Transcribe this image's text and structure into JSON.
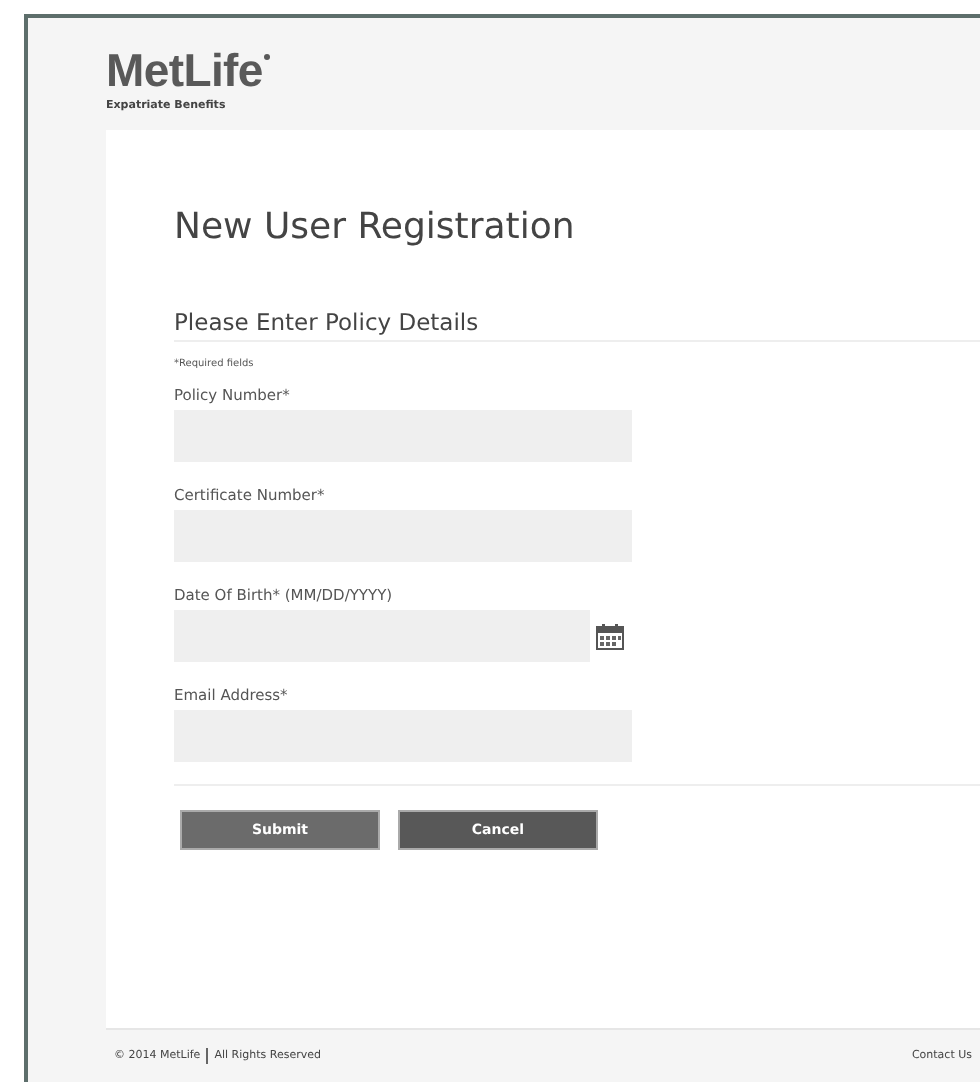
{
  "header": {
    "logo": "MetLife",
    "subtitle": "Expatriate Benefits"
  },
  "page_title": "New User Registration",
  "section_title": "Please Enter Policy Details",
  "required_note": "*Required fields",
  "fields": [
    {
      "label": "Policy Number*",
      "kind": "text"
    },
    {
      "label": "Certificate Number*",
      "kind": "text"
    },
    {
      "label": "Date Of Birth* (MM/DD/YYYY)",
      "kind": "date"
    },
    {
      "label": "Email Address*",
      "kind": "text"
    }
  ],
  "buttons": [
    {
      "label": "Submit",
      "kind": "primary"
    },
    {
      "label": "Cancel",
      "kind": "secondary"
    }
  ],
  "footer": {
    "copyright": "© 2014 MetLife",
    "rights": "All Rights Reserved",
    "contact": "Contact Us"
  }
}
